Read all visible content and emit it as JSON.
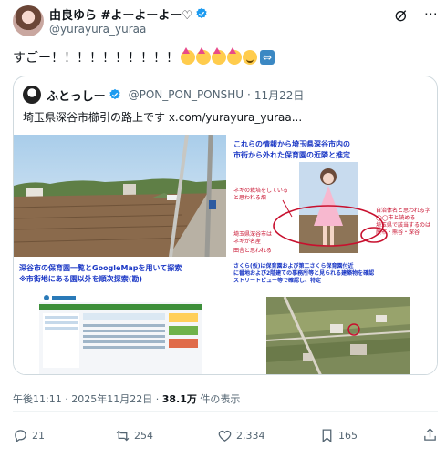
{
  "author": {
    "display_name": "由良ゆら #よーよーよー♡",
    "handle": "@yurayura_yuraa"
  },
  "tweet": {
    "text": "すごー！！！！！！！！！！"
  },
  "quote": {
    "display_name": "ふとっしー",
    "handle": "@PON_PON_PONSHU",
    "date": "11月22日",
    "text": "埼玉県深谷市櫛引の路上です  x.com/yurayura_yuraa..."
  },
  "media": {
    "panel_tr_title": [
      "これらの情報から埼玉県深谷市内の",
      "市街から外れた保育園の近隣と推定"
    ],
    "panel_tr_notes": [
      "ネギの栽培をしている",
      "と思われる畑",
      "埼玉県深谷市は",
      "ネギが名産",
      "田舎と思われる",
      "自治体名と思われる字",
      "◯◯市と読める",
      "埼玉県で該当するのは",
      "蕨市・熊谷・深谷"
    ],
    "panel_bl_title": [
      "深谷市の保育園一覧とGoogleMapを用いて探索",
      "※市街地にある園以外を順次探索(勘)"
    ],
    "panel_br_title": [
      "さくら(仮)は保育園および第二さくら保育園付近",
      "に番地および2階建ての事務所等と見られる建築物を確認",
      "ストリートビュー等で確認し、特定"
    ]
  },
  "meta": {
    "time": "午後11:11",
    "date": "2025年11月22日",
    "views_count": "38.1万",
    "views_label": "件の表示"
  },
  "actions": {
    "replies": "21",
    "reposts": "254",
    "likes": "2,334",
    "bookmarks": "165"
  },
  "colors": {
    "verified": "#1d9bf0",
    "text": "#0f1419",
    "muted": "#536471",
    "border": "#cfd9de",
    "slide_blue": "#1a37c5",
    "slide_red": "#c8102e"
  }
}
